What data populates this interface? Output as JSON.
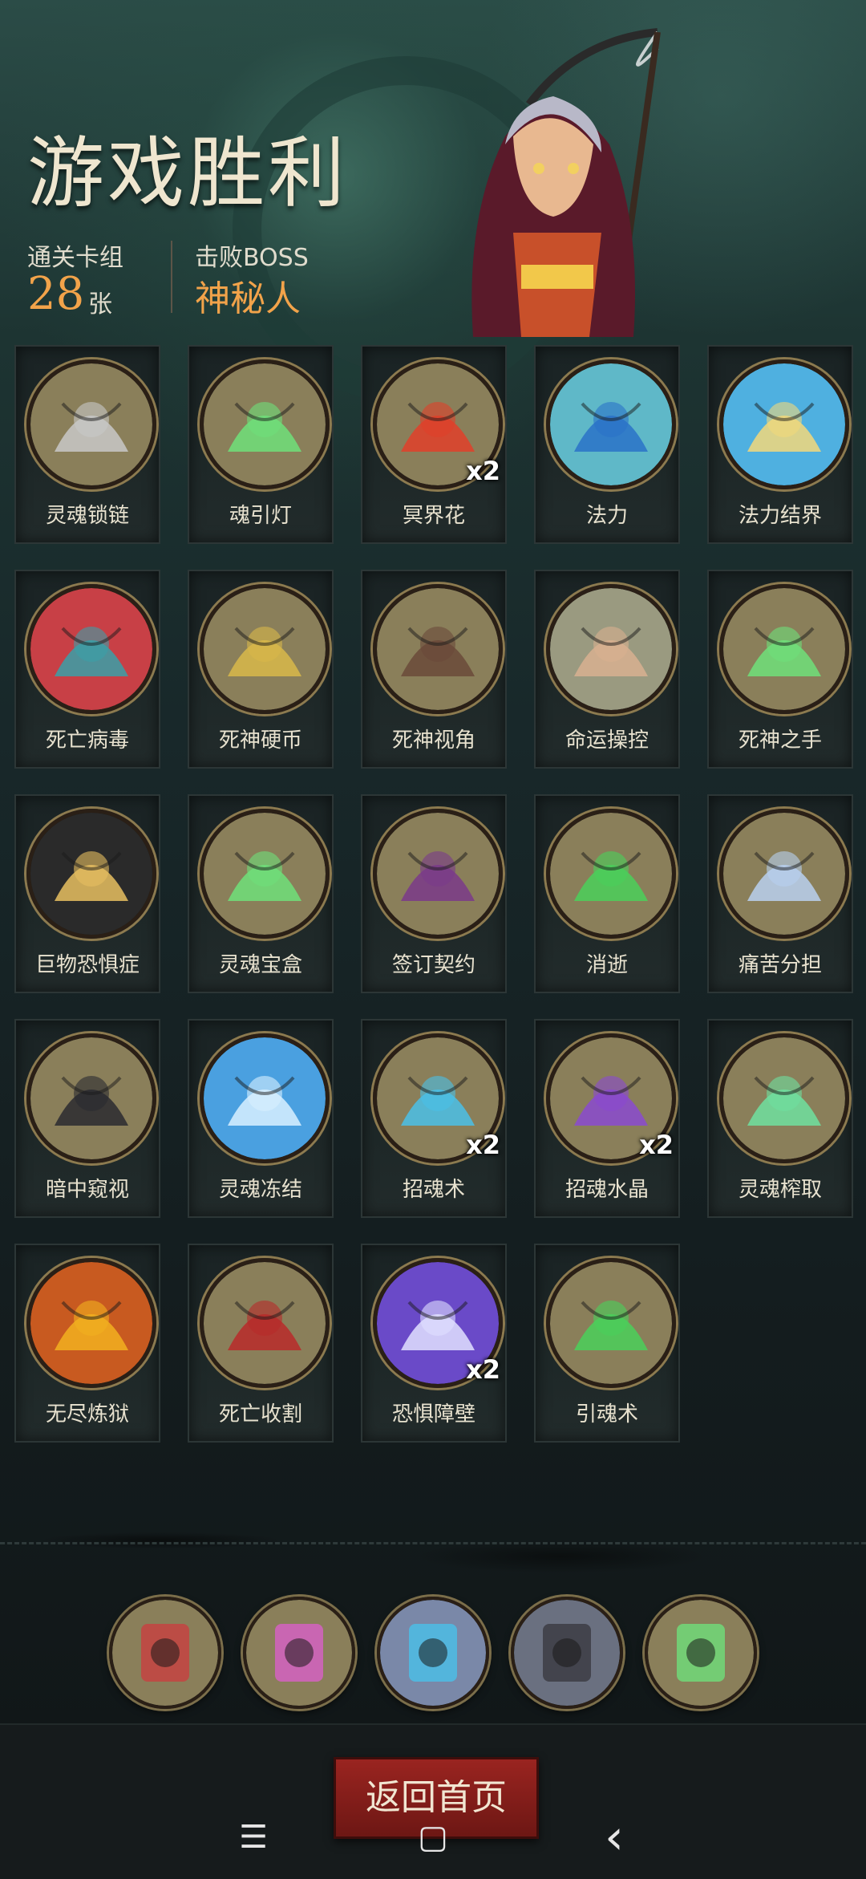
{
  "header": {
    "title": "游戏胜利",
    "cards_label": "通关卡组",
    "cards_count": "28",
    "cards_unit": "张",
    "boss_label": "击败BOSS",
    "boss_name": "神秘人"
  },
  "cards": [
    {
      "label": "灵魂锁链",
      "badge": "",
      "color": "#8a7f5a",
      "accent": "#c8c8c8"
    },
    {
      "label": "魂引灯",
      "badge": "",
      "color": "#8a7f5a",
      "accent": "#6ee07a"
    },
    {
      "label": "冥界花",
      "badge": "x2",
      "color": "#8a7f5a",
      "accent": "#e0402a"
    },
    {
      "label": "法力",
      "badge": "",
      "color": "#5fb8c8",
      "accent": "#2a72c8"
    },
    {
      "label": "法力结界",
      "badge": "",
      "color": "#4fb0e0",
      "accent": "#f2d87a"
    },
    {
      "label": "死亡病毒",
      "badge": "",
      "color": "#c84046",
      "accent": "#3aa0a8"
    },
    {
      "label": "死神硬币",
      "badge": "",
      "color": "#8a7f5a",
      "accent": "#d8b84a"
    },
    {
      "label": "死神视角",
      "badge": "",
      "color": "#8a7f5a",
      "accent": "#6a4a3a"
    },
    {
      "label": "命运操控",
      "badge": "",
      "color": "#9a9a80",
      "accent": "#d8b090"
    },
    {
      "label": "死神之手",
      "badge": "",
      "color": "#8a7f5a",
      "accent": "#6ee07a"
    },
    {
      "label": "巨物恐惧症",
      "badge": "",
      "color": "#2a2a2a",
      "accent": "#e8c060"
    },
    {
      "label": "灵魂宝盒",
      "badge": "",
      "color": "#8a7f5a",
      "accent": "#6ee07a"
    },
    {
      "label": "签订契约",
      "badge": "",
      "color": "#8a7f5a",
      "accent": "#7a3a8a"
    },
    {
      "label": "消逝",
      "badge": "",
      "color": "#8a7f5a",
      "accent": "#4ad05a"
    },
    {
      "label": "痛苦分担",
      "badge": "",
      "color": "#8a7f5a",
      "accent": "#b8d0f0"
    },
    {
      "label": "暗中窥视",
      "badge": "",
      "color": "#8a7f5a",
      "accent": "#2a2a30"
    },
    {
      "label": "灵魂冻结",
      "badge": "",
      "color": "#4aa0e0",
      "accent": "#d8f0ff"
    },
    {
      "label": "招魂术",
      "badge": "x2",
      "color": "#8a7f5a",
      "accent": "#4ac0e8"
    },
    {
      "label": "招魂水晶",
      "badge": "x2",
      "color": "#8a7f5a",
      "accent": "#8a4ad0"
    },
    {
      "label": "灵魂榨取",
      "badge": "",
      "color": "#8a7f5a",
      "accent": "#6ee0a0"
    },
    {
      "label": "无尽炼狱",
      "badge": "",
      "color": "#c85a20",
      "accent": "#f2b020"
    },
    {
      "label": "死亡收割",
      "badge": "",
      "color": "#8a7f5a",
      "accent": "#b82a2a"
    },
    {
      "label": "恐惧障壁",
      "badge": "x2",
      "color": "#6a4ac8",
      "accent": "#e0e0ff"
    },
    {
      "label": "引魂术",
      "badge": "",
      "color": "#8a7f5a",
      "accent": "#4ad05a"
    }
  ],
  "relics": [
    {
      "icon": "soul-card-relic-icon",
      "color": "#8a7f5a",
      "accent": "#c84040"
    },
    {
      "icon": "balloon-clown-relic-icon",
      "color": "#8a7f5a",
      "accent": "#d860c8"
    },
    {
      "icon": "lightning-compass-relic-icon",
      "color": "#7a88a8",
      "accent": "#4ac0e8"
    },
    {
      "icon": "dark-cloud-relic-icon",
      "color": "#6a7080",
      "accent": "#3a3a40"
    },
    {
      "icon": "zombie-doctor-relic-icon",
      "color": "#8a7f5a",
      "accent": "#6ee07a"
    }
  ],
  "footer": {
    "home_button": "返回首页",
    "nav_menu": "☰",
    "nav_home": "▢",
    "nav_back": "‹"
  }
}
